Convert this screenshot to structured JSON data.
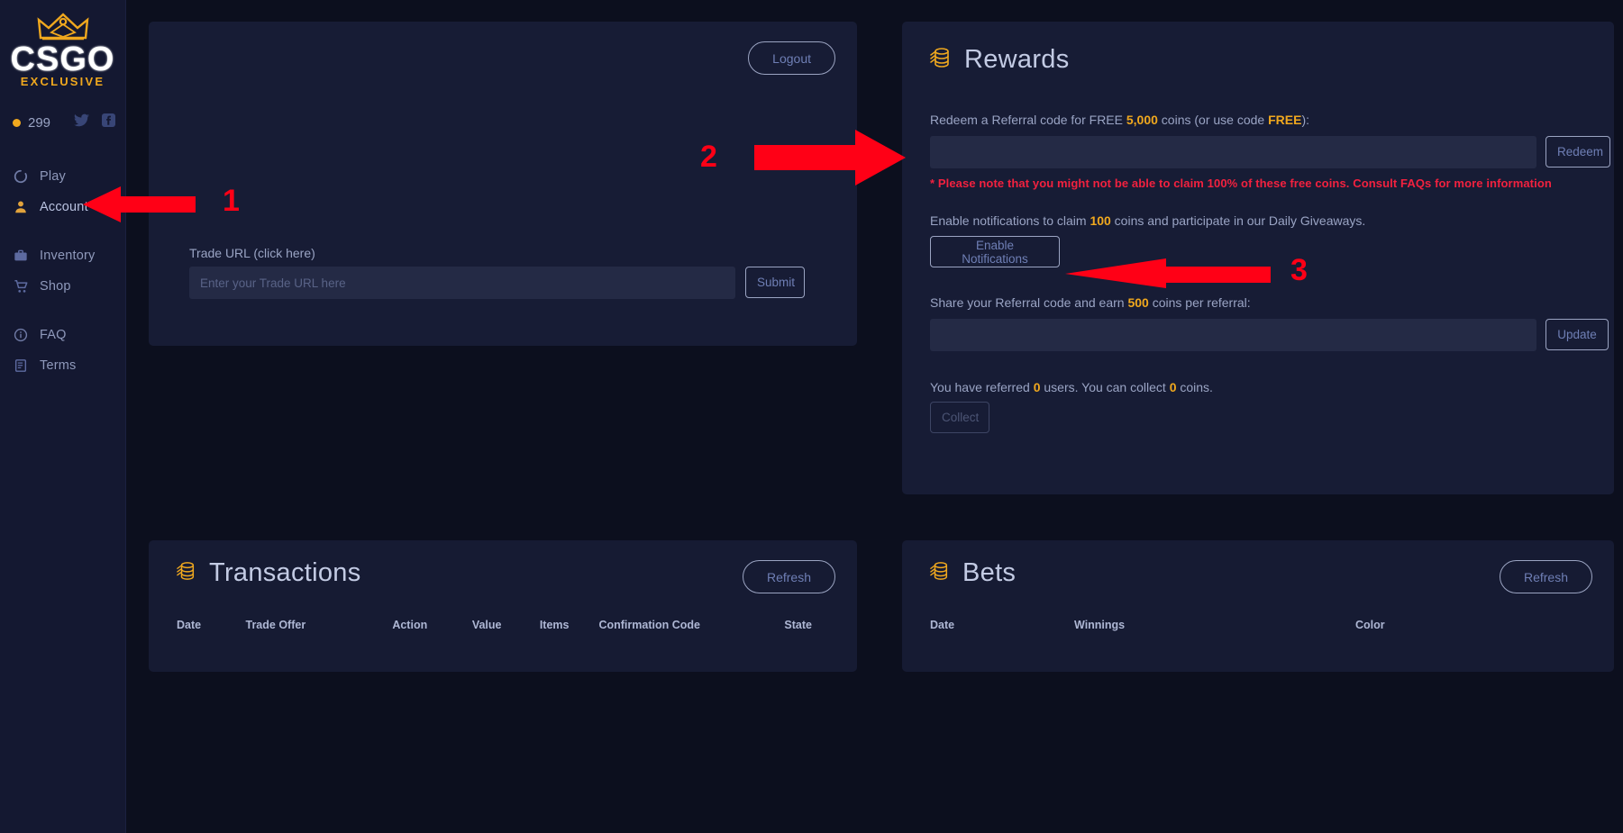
{
  "brand": {
    "name": "CSGO",
    "subtitle": "EXCLUSIVE",
    "crown_icon": "crown-icon"
  },
  "sidebar": {
    "balance": "299",
    "coin_icon": "coin-dot-icon",
    "socials": [
      {
        "name": "twitter-icon",
        "label": "Twitter"
      },
      {
        "name": "facebook-icon",
        "label": "Facebook"
      }
    ],
    "groups": [
      {
        "items": [
          {
            "icon": "play-circle-icon",
            "label": "Play",
            "active": false
          },
          {
            "icon": "user-icon",
            "label": "Account",
            "active": true
          }
        ]
      },
      {
        "items": [
          {
            "icon": "briefcase-icon",
            "label": "Inventory",
            "active": false
          },
          {
            "icon": "cart-icon",
            "label": "Shop",
            "active": false
          }
        ]
      },
      {
        "items": [
          {
            "icon": "info-circle-icon",
            "label": "FAQ",
            "active": false
          },
          {
            "icon": "document-icon",
            "label": "Terms",
            "active": false
          }
        ]
      }
    ]
  },
  "account": {
    "logout_label": "Logout",
    "trade_url_label": "Trade URL (click here)",
    "trade_url_value": "",
    "trade_url_placeholder": "Enter your Trade URL here",
    "submit_label": "Submit"
  },
  "rewards": {
    "icon": "coins-icon",
    "title": "Rewards",
    "redeem_text_pre": "Redeem a Referral code for FREE ",
    "redeem_amount": "5,000",
    "redeem_text_mid": " coins (or use code ",
    "redeem_code": "FREE",
    "redeem_text_post": "):",
    "redeem_input_value": "",
    "redeem_input_placeholder": "",
    "redeem_button_label": "Redeem",
    "warning": "* Please note that you might not be able to claim 100% of these free coins. Consult FAQs for more information",
    "notify_text_pre": "Enable notifications to claim ",
    "notify_amount": "100",
    "notify_text_post": " coins and participate in our Daily Giveaways.",
    "notify_button_label": "Enable Notifications",
    "share_text_pre": "Share your Referral code and earn ",
    "share_amount": "500",
    "share_text_post": " coins per referral:",
    "share_input_value": "",
    "share_input_placeholder": "",
    "update_button_label": "Update",
    "referred_pre": "You have referred ",
    "referred_count": "0",
    "referred_mid": " users. You can collect ",
    "collect_count": "0",
    "referred_post": " coins.",
    "collect_button_label": "Collect"
  },
  "transactions": {
    "icon": "coins-icon",
    "title": "Transactions",
    "refresh_label": "Refresh",
    "columns": [
      "Date",
      "Trade Offer",
      "Action",
      "Value",
      "Items",
      "Confirmation Code",
      "State"
    ],
    "rows": []
  },
  "bets": {
    "icon": "coins-icon",
    "title": "Bets",
    "refresh_label": "Refresh",
    "columns": [
      "Date",
      "Winnings",
      "Color"
    ],
    "rows": []
  },
  "annotations": {
    "color": "#ff0016",
    "markers": [
      {
        "number": "1",
        "points_to": "sidebar-item-account",
        "direction": "left"
      },
      {
        "number": "2",
        "points_to": "redeem-code-input",
        "direction": "right"
      },
      {
        "number": "3",
        "points_to": "enable-notifications-button",
        "direction": "left"
      }
    ]
  }
}
